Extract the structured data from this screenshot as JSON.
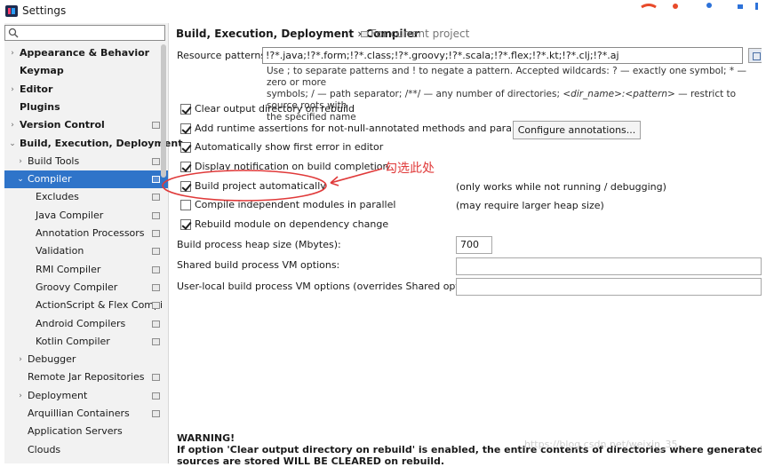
{
  "window": {
    "title": "Settings"
  },
  "sidebar": {
    "search": {
      "value": ""
    },
    "items": [
      {
        "label": "Appearance & Behavior",
        "arrow": "›",
        "indent": 0,
        "bold": true,
        "proj": false,
        "selected": false
      },
      {
        "label": "Keymap",
        "arrow": "",
        "indent": 0,
        "bold": true,
        "proj": false,
        "selected": false
      },
      {
        "label": "Editor",
        "arrow": "›",
        "indent": 0,
        "bold": true,
        "proj": false,
        "selected": false
      },
      {
        "label": "Plugins",
        "arrow": "",
        "indent": 0,
        "bold": true,
        "proj": false,
        "selected": false
      },
      {
        "label": "Version Control",
        "arrow": "›",
        "indent": 0,
        "bold": true,
        "proj": true,
        "selected": false
      },
      {
        "label": "Build, Execution, Deployment",
        "arrow": "⌄",
        "indent": 0,
        "bold": true,
        "proj": false,
        "selected": false
      },
      {
        "label": "Build Tools",
        "arrow": "›",
        "indent": 1,
        "bold": false,
        "proj": true,
        "selected": false
      },
      {
        "label": "Compiler",
        "arrow": "⌄",
        "indent": 1,
        "bold": false,
        "proj": true,
        "selected": true
      },
      {
        "label": "Excludes",
        "arrow": "",
        "indent": 2,
        "bold": false,
        "proj": true,
        "selected": false
      },
      {
        "label": "Java Compiler",
        "arrow": "",
        "indent": 2,
        "bold": false,
        "proj": true,
        "selected": false
      },
      {
        "label": "Annotation Processors",
        "arrow": "",
        "indent": 2,
        "bold": false,
        "proj": true,
        "selected": false
      },
      {
        "label": "Validation",
        "arrow": "",
        "indent": 2,
        "bold": false,
        "proj": true,
        "selected": false
      },
      {
        "label": "RMI Compiler",
        "arrow": "",
        "indent": 2,
        "bold": false,
        "proj": true,
        "selected": false
      },
      {
        "label": "Groovy Compiler",
        "arrow": "",
        "indent": 2,
        "bold": false,
        "proj": true,
        "selected": false
      },
      {
        "label": "ActionScript & Flex Compi",
        "arrow": "",
        "indent": 2,
        "bold": false,
        "proj": true,
        "selected": false
      },
      {
        "label": "Android Compilers",
        "arrow": "",
        "indent": 2,
        "bold": false,
        "proj": true,
        "selected": false
      },
      {
        "label": "Kotlin Compiler",
        "arrow": "",
        "indent": 2,
        "bold": false,
        "proj": true,
        "selected": false
      },
      {
        "label": "Debugger",
        "arrow": "›",
        "indent": 1,
        "bold": false,
        "proj": false,
        "selected": false
      },
      {
        "label": "Remote Jar Repositories",
        "arrow": "",
        "indent": 1,
        "bold": false,
        "proj": true,
        "selected": false
      },
      {
        "label": "Deployment",
        "arrow": "›",
        "indent": 1,
        "bold": false,
        "proj": true,
        "selected": false
      },
      {
        "label": "Arquillian Containers",
        "arrow": "",
        "indent": 1,
        "bold": false,
        "proj": true,
        "selected": false
      },
      {
        "label": "Application Servers",
        "arrow": "",
        "indent": 1,
        "bold": false,
        "proj": false,
        "selected": false
      },
      {
        "label": "Clouds",
        "arrow": "",
        "indent": 1,
        "bold": false,
        "proj": false,
        "selected": false
      }
    ]
  },
  "content": {
    "breadcrumb": {
      "parent": "Build, Execution, Deployment",
      "separator": "›",
      "current": "Compiler"
    },
    "breadcrumb_note": "For current project",
    "resource_patterns": {
      "label": "Resource patterns:",
      "value": "!?*.java;!?*.form;!?*.class;!?*.groovy;!?*.scala;!?*.flex;!?*.kt;!?*.clj;!?*.aj"
    },
    "help": {
      "line1": "Use ; to separate patterns and ! to negate a pattern. Accepted wildcards: ? — exactly one symbol; * — zero or more",
      "line2a": "symbols; / — path separator; /**/ — any number of directories; ",
      "line2b": "<dir_name>:<pattern>",
      "line2c": " — restrict to source roots with",
      "line3": "the specified name"
    },
    "options": [
      {
        "label": "Clear output directory on rebuild",
        "checked": true,
        "note": ""
      },
      {
        "label": "Add runtime assertions for not-null-annotated methods and parameters",
        "checked": true,
        "note": ""
      },
      {
        "label": "Automatically show first error in editor",
        "checked": true,
        "note": ""
      },
      {
        "label": "Display notification on build completion",
        "checked": true,
        "note": ""
      },
      {
        "label": "Build project automatically",
        "checked": true,
        "note": "(only works while not running / debugging)"
      },
      {
        "label": "Compile independent modules in parallel",
        "checked": false,
        "note": "(may require larger heap size)"
      },
      {
        "label": "Rebuild module on dependency change",
        "checked": true,
        "note": ""
      }
    ],
    "configure_button": "Configure annotations...",
    "heap": {
      "label": "Build process heap size (Mbytes):",
      "value": "700"
    },
    "shared_vm": {
      "label": "Shared build process VM options:",
      "value": ""
    },
    "user_vm": {
      "label": "User-local build process VM options (overrides Shared options):",
      "value": ""
    },
    "warning": {
      "title": "WARNING!",
      "text": "If option 'Clear output directory on rebuild' is enabled, the entire contents of directories where generated sources are stored WILL BE CLEARED on rebuild."
    }
  },
  "annotation": {
    "text": "勾选此处",
    "color": "#e03a3a"
  },
  "watermark": "https://blog.csdn.net/weixin_35...",
  "colors": {
    "selection": "#2f74c9",
    "sidebar_bg": "#f2f2f2",
    "annotation": "#e03a3a"
  }
}
